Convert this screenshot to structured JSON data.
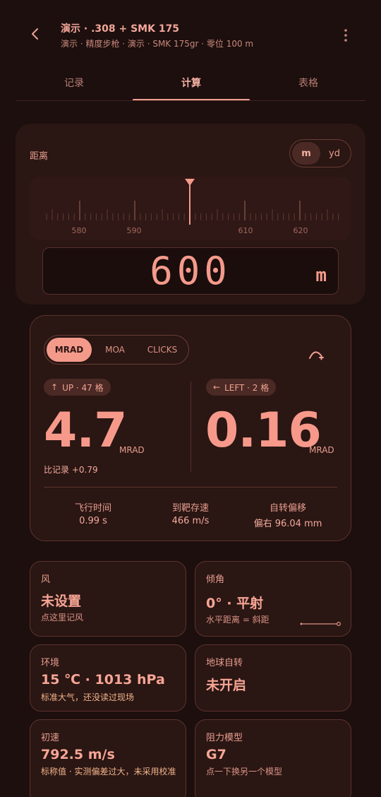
{
  "header": {
    "title": "演示 · .308 + SMK 175",
    "subtitle": "演示 · 精度步枪 · 演示 · SMK 175gr · 零位 100 m",
    "back_icon": "chevron-left-icon",
    "more_icon": "more-vert-icon"
  },
  "tabs": [
    {
      "label": "记录"
    },
    {
      "label": "计算"
    },
    {
      "label": "表格"
    }
  ],
  "distance": {
    "label": "距离",
    "units": [
      "m",
      "yd"
    ],
    "selected_unit": "m",
    "ruler_labels": [
      "580",
      "590",
      "610",
      "620"
    ],
    "value": "600",
    "unit_display": "m"
  },
  "result": {
    "modes": [
      "MRAD",
      "MOA",
      "CLICKS"
    ],
    "selected_mode": "MRAD",
    "elevation": {
      "chip": "UP · 47 格",
      "value": "4.7",
      "unit": "MRAD",
      "compare": "比记录 +0.79"
    },
    "windage": {
      "chip": "LEFT · 2 格",
      "value": "0.16",
      "unit": "MRAD"
    },
    "stats": [
      {
        "label": "飞行时间",
        "value": "0.99 s"
      },
      {
        "label": "到靶存速",
        "value": "466 m/s"
      },
      {
        "label": "自转偏移",
        "value": "偏右 96.04 mm"
      }
    ]
  },
  "cards": {
    "wind": {
      "label": "风",
      "value": "未设置",
      "note": "点这里记风"
    },
    "incline": {
      "label": "倾角",
      "value": "0° · 平射",
      "note": "水平距离 = 斜距"
    },
    "environment": {
      "label": "环境",
      "value": "15 ℃ · 1013 hPa",
      "note": "标准大气，还没读过现场"
    },
    "coriolis": {
      "label": "地球自转",
      "value": "未开启"
    },
    "muzzle": {
      "label": "初速",
      "value": "792.5 m/s",
      "note": "标称值 · 实测偏差过大，未采用校准"
    },
    "drag": {
      "label": "阻力模型",
      "value": "G7",
      "note": "点一下换另一个模型"
    }
  },
  "colors": {
    "background": "#1c0f0e",
    "accent": "#f49a8b",
    "card": "#2a1613",
    "warning_text": "#f1b48a"
  }
}
